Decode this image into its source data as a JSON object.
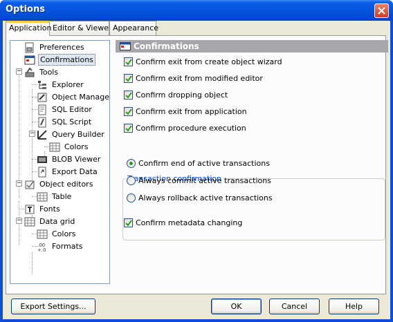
{
  "window": {
    "title": "Options"
  },
  "tabs": [
    {
      "label": "Application",
      "active": true
    },
    {
      "label": "Editor & Viewers",
      "active": false
    },
    {
      "label": "Appearance",
      "active": false
    }
  ],
  "tree": {
    "preferences": "Preferences",
    "confirmations": "Confirmations",
    "tools": "Tools",
    "explorer": "Explorer",
    "object_manager": "Object Manager",
    "sql_editor": "SQL Editor",
    "sql_script": "SQL Script",
    "query_builder": "Query Builder",
    "qb_colors": "Colors",
    "blob_viewer": "BLOB Viewer",
    "export_data": "Export Data",
    "object_editors": "Object editors",
    "table": "Table",
    "fonts": "Fonts",
    "data_grid": "Data grid",
    "dg_colors": "Colors",
    "formats": "Formats"
  },
  "section": {
    "title": "Confirmations"
  },
  "checks": [
    {
      "label": "Confirm exit from create object wizard",
      "checked": true
    },
    {
      "label": "Confirm exit from modified editor",
      "checked": true
    },
    {
      "label": "Confirm dropping object",
      "checked": true
    },
    {
      "label": "Confirm exit from application",
      "checked": true
    },
    {
      "label": "Confirm procedure execution",
      "checked": true
    }
  ],
  "transaction": {
    "group_label": "Transaction confirmation",
    "options": [
      {
        "label": "Confirm end of active transactions",
        "selected": true
      },
      {
        "label": "Always commit active transactions",
        "selected": false
      },
      {
        "label": "Always rollback active transactions",
        "selected": false
      }
    ]
  },
  "metadata_check": {
    "label": "Confirm metadata changing",
    "checked": true
  },
  "buttons": {
    "export_settings": "Export Settings...",
    "ok": "OK",
    "cancel": "Cancel",
    "help": "Help"
  },
  "colors": {
    "titlebar": "#0554e0",
    "face": "#ece9d8",
    "header": "#a7a6aa",
    "check": "#21a121"
  }
}
